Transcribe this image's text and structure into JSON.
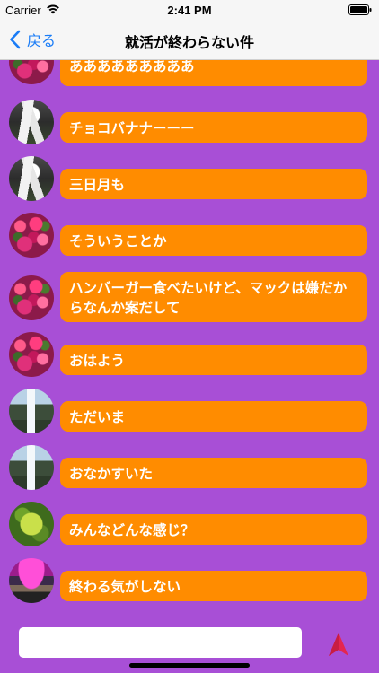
{
  "status": {
    "carrier": "Carrier",
    "time": "2:41 PM"
  },
  "nav": {
    "back_label": "戻る",
    "title": "就活が終わらない件"
  },
  "messages": [
    {
      "text": "あああああああああ",
      "avatar": "flowers-photo"
    },
    {
      "text": "チョコバナナーーー",
      "avatar": "hands-photo"
    },
    {
      "text": "三日月も",
      "avatar": "hands-photo"
    },
    {
      "text": "そういうことか",
      "avatar": "flowers-photo"
    },
    {
      "text": "ハンバーガー食べたいけど、マックは嫌だからなんか案だして",
      "avatar": "flowers-photo"
    },
    {
      "text": "おはよう",
      "avatar": "flowers-photo"
    },
    {
      "text": "ただいま",
      "avatar": "waterfall-photo"
    },
    {
      "text": "おなかすいた",
      "avatar": "waterfall-photo"
    },
    {
      "text": "みんなどんな感じ？",
      "avatar": "leaf-photo"
    },
    {
      "text": "終わる気がしない",
      "avatar": "palace-photo"
    }
  ],
  "input": {
    "value": "",
    "placeholder": ""
  },
  "colors": {
    "background": "#a84fd6",
    "bubble": "#ff8c00",
    "send_icon": "#e4264f",
    "back_link": "#1a7cf6"
  }
}
